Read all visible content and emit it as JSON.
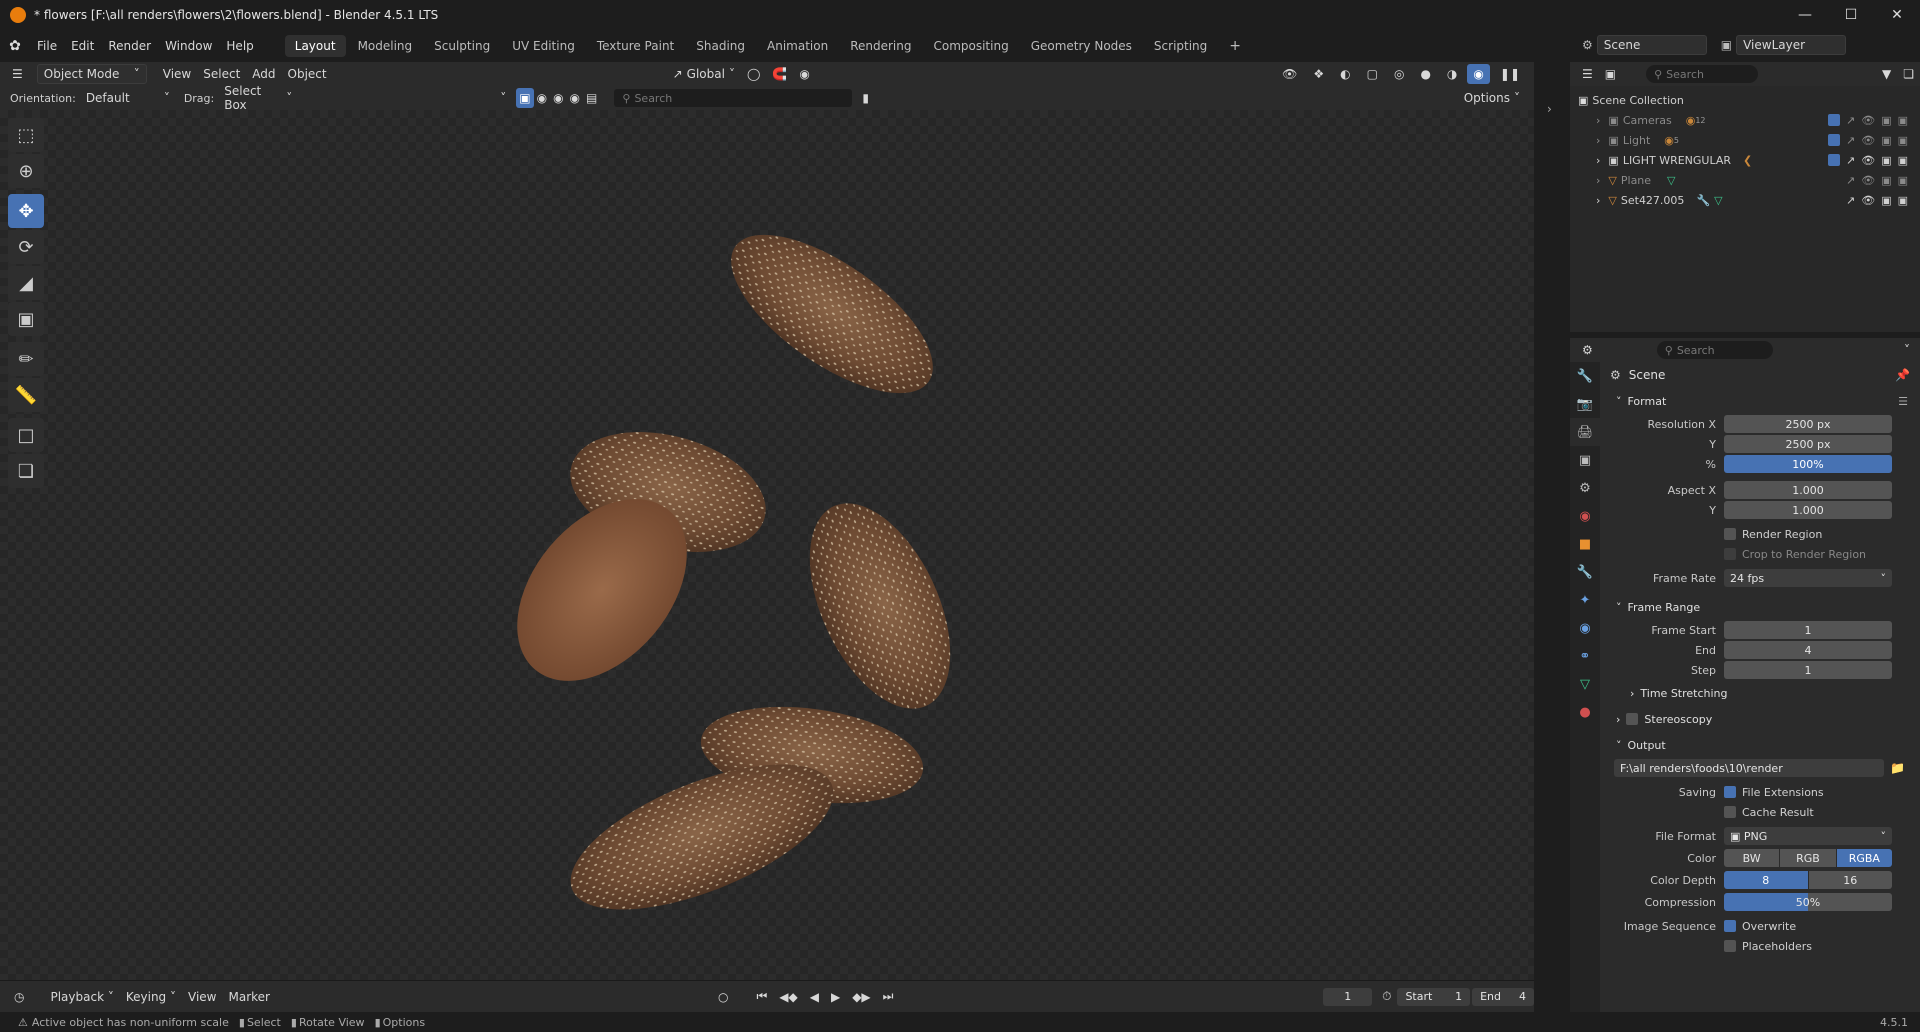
{
  "window": {
    "title": "* flowers [F:\\all renders\\flowers\\2\\flowers.blend] - Blender 4.5.1 LTS"
  },
  "menu": {
    "items": [
      "File",
      "Edit",
      "Render",
      "Window",
      "Help"
    ]
  },
  "workspaces": {
    "tabs": [
      "Layout",
      "Modeling",
      "Sculpting",
      "UV Editing",
      "Texture Paint",
      "Shading",
      "Animation",
      "Rendering",
      "Compositing",
      "Geometry Nodes",
      "Scripting"
    ],
    "active": "Layout",
    "add": "+"
  },
  "viewport_header": {
    "mode": "Object Mode",
    "view": "View",
    "select": "Select",
    "add": "Add",
    "object": "Object",
    "transform": "Global"
  },
  "tool_settings": {
    "orientation_label": "Orientation:",
    "orientation_value": "Default",
    "drag_label": "Drag:",
    "drag_value": "Select Box",
    "search_placeholder": "Search",
    "options": "Options"
  },
  "scene_selector": {
    "scene": "Scene",
    "view_layer": "ViewLayer"
  },
  "outliner": {
    "search_placeholder": "Search",
    "root": "Scene Collection",
    "items": [
      {
        "name": "Cameras",
        "badge": "12",
        "dim": true
      },
      {
        "name": "Light",
        "badge": "5",
        "dim": true
      },
      {
        "name": "LIGHT WRENGULAR",
        "badge": "",
        "dim": false
      },
      {
        "name": "Plane",
        "badge": "",
        "dim": true
      },
      {
        "name": "Set427.005",
        "badge": "",
        "dim": false
      }
    ]
  },
  "properties": {
    "search_placeholder": "Search",
    "context": "Scene",
    "format": {
      "title": "Format",
      "res_x_label": "Resolution X",
      "res_x": "2500 px",
      "res_y_label": "Y",
      "res_y": "2500 px",
      "pct_label": "%",
      "pct": "100%",
      "aspect_x_label": "Aspect X",
      "aspect_x": "1.000",
      "aspect_y_label": "Y",
      "aspect_y": "1.000",
      "render_region": "Render Region",
      "crop": "Crop to Render Region",
      "frame_rate_label": "Frame Rate",
      "frame_rate": "24 fps"
    },
    "frame_range": {
      "title": "Frame Range",
      "start_label": "Frame Start",
      "start": "1",
      "end_label": "End",
      "end": "4",
      "step_label": "Step",
      "step": "1",
      "time_stretching": "Time Stretching"
    },
    "stereoscopy": {
      "title": "Stereoscopy"
    },
    "output": {
      "title": "Output",
      "path": "F:\\all renders\\foods\\10\\render",
      "saving_label": "Saving",
      "file_ext": "File Extensions",
      "cache": "Cache Result",
      "file_format_label": "File Format",
      "file_format": "PNG",
      "color_label": "Color",
      "color_opts": [
        "BW",
        "RGB",
        "RGBA"
      ],
      "color_active": "RGBA",
      "depth_label": "Color Depth",
      "depth_opts": [
        "8",
        "16"
      ],
      "compression_label": "Compression",
      "compression": "50%",
      "image_seq_label": "Image Sequence",
      "overwrite": "Overwrite",
      "placeholders": "Placeholders"
    }
  },
  "timeline": {
    "playback": "Playback",
    "keying": "Keying",
    "view": "View",
    "marker": "Marker",
    "current_frame": "1",
    "start_label": "Start",
    "start": "1",
    "end_label": "End",
    "end": "4"
  },
  "statusbar": {
    "warning": "Active object has non-uniform scale",
    "select": "Select",
    "rotate": "Rotate View",
    "options": "Options",
    "version": "4.5.1"
  }
}
